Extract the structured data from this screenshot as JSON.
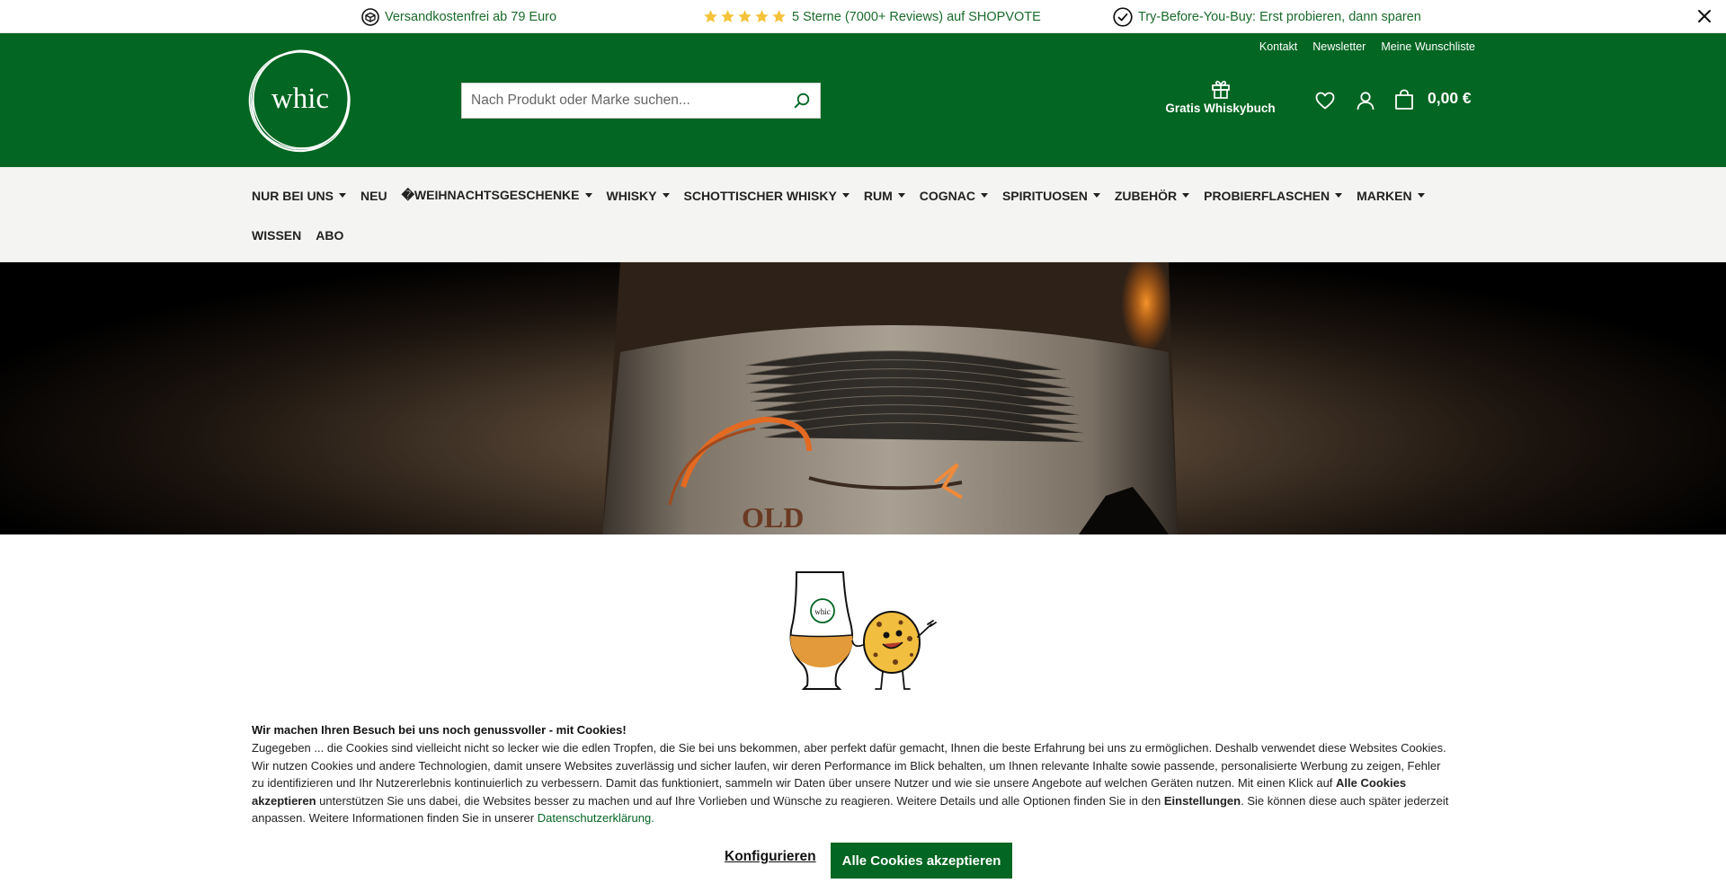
{
  "topbar": {
    "shipping": "Versandkostenfrei ab 79 Euro",
    "rating": "5 Sterne (7000+ Reviews) auf SHOPVOTE",
    "rating_stars": 5,
    "trial": "Try-Before-You-Buy: Erst probieren, dann sparen",
    "star_color": "#f5c33b"
  },
  "header": {
    "logo_text": "whic",
    "service_links": [
      "Kontakt",
      "Newsletter",
      "Meine Wunschliste"
    ],
    "search_placeholder": "Nach Produkt oder Marke suchen...",
    "gift_label": "Gratis Whiskybuch",
    "cart_total": "0,00 €",
    "brand_color": "#036622"
  },
  "nav": {
    "row1": [
      {
        "label": "NUR BEI UNS",
        "dropdown": true
      },
      {
        "label": "NEU",
        "dropdown": false
      },
      {
        "label": "�WEIHNACHTSGESCHENKE",
        "dropdown": true
      },
      {
        "label": "WHISKY",
        "dropdown": true
      },
      {
        "label": "SCHOTTISCHER WHISKY",
        "dropdown": true
      },
      {
        "label": "RUM",
        "dropdown": true
      },
      {
        "label": "COGNAC",
        "dropdown": true
      },
      {
        "label": "SPIRITUOSEN",
        "dropdown": true
      },
      {
        "label": "ZUBEHÖR",
        "dropdown": true
      },
      {
        "label": "PROBIERFLASCHEN",
        "dropdown": true
      },
      {
        "label": "MARKEN",
        "dropdown": true
      }
    ],
    "row2": [
      {
        "label": "WISSEN",
        "dropdown": false
      },
      {
        "label": "ABO",
        "dropdown": false
      }
    ]
  },
  "hero": {
    "label_text": "OLD"
  },
  "cookie": {
    "title": "Wir machen Ihren Besuch bei uns noch genussvoller - mit Cookies!",
    "text_1": "Zugegeben ... die Cookies sind vielleicht nicht so lecker wie die edlen Tropfen, die Sie bei uns bekommen, aber perfekt dafür gemacht, Ihnen die beste Erfahrung bei uns zu ermöglichen. Deshalb verwendet diese Websites Cookies. Wir nutzen Cookies und andere Technologien, damit unsere Websites zuverlässig und sicher laufen, wir deren Performance im Blick behalten, um Ihnen relevante Inhalte sowie passende, personalisierte Werbung zu zeigen, Fehler zu identifizieren und Ihr Nutzererlebnis kontinuierlich zu verbessern. Damit das funktioniert, sammeln wir Daten über unsere Nutzer und wie sie unsere Angebote auf welchen Geräten nutzen. Mit einen Klick auf ",
    "text_bold_1": "Alle Cookies akzeptieren",
    "text_2": " unterstützen Sie uns dabei, die Websites besser zu machen und auf Ihre Vorlieben und Wünsche zu reagieren. Weitere Details und alle Optionen finden Sie in den ",
    "text_bold_2": "Einstellungen",
    "text_3": ". Sie können diese auch später jederzeit anpassen. Weitere Informationen finden Sie in unserer ",
    "privacy_link": "Datenschutzerklärung.",
    "glass_logo": "whic",
    "configure_label": "Konfigurieren",
    "accept_label": "Alle Cookies akzeptieren"
  }
}
